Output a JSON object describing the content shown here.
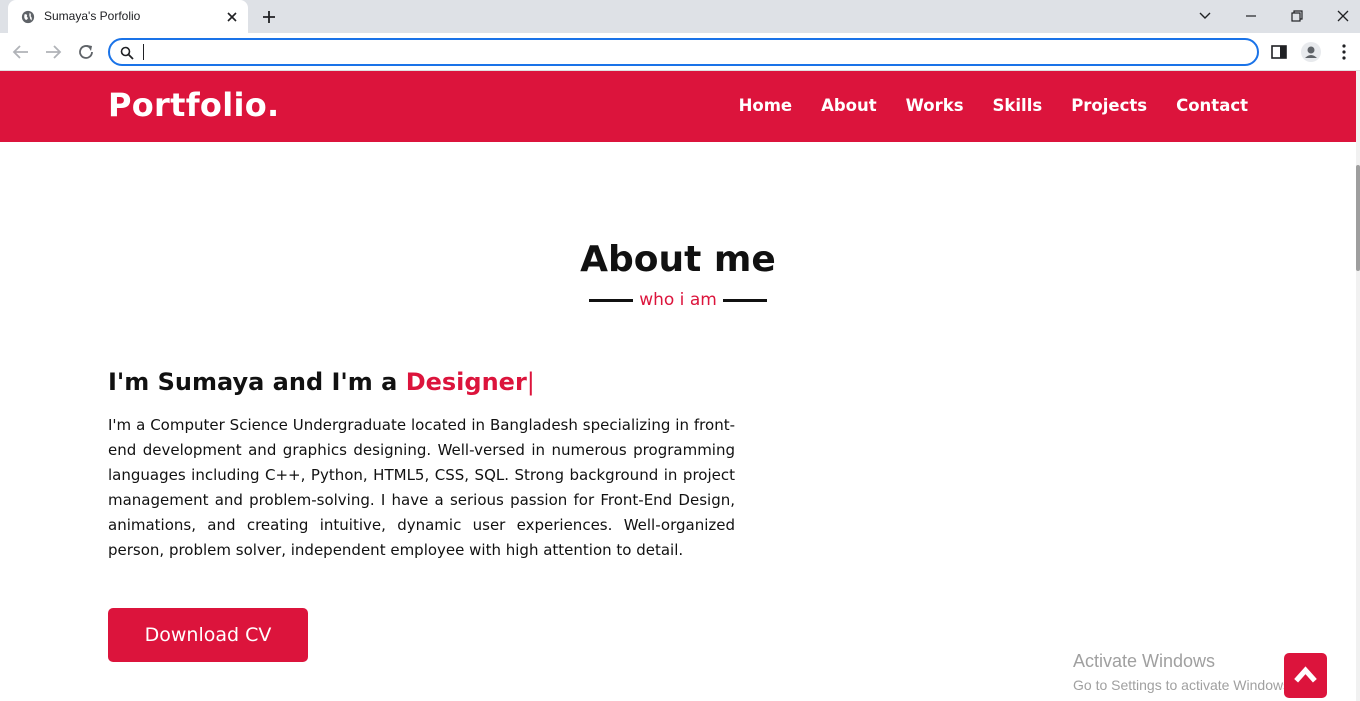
{
  "browser": {
    "tab_title": "Sumaya's Porfolio",
    "address_value": "",
    "address_placeholder": ""
  },
  "site": {
    "logo": "Portfolio.",
    "nav": [
      "Home",
      "About",
      "Works",
      "Skills",
      "Projects",
      "Contact"
    ]
  },
  "about": {
    "title": "About me",
    "subtitle": "who i am",
    "heading_prefix": "I'm Sumaya and I'm a ",
    "heading_highlight": "Designer",
    "heading_cursor": "|",
    "paragraph": "I'm a Computer Science Undergraduate located in Bangladesh specializing in front-end development and graphics designing. Well-versed in numerous programming languages including C++, Python, HTML5, CSS, SQL. Strong background in project management and problem-solving. I have a serious passion for Front-End Design, animations, and creating intuitive, dynamic user experiences. Well-organized person, problem solver, independent employee with high attention to detail.",
    "cv_button": "Download CV"
  },
  "os_watermark": {
    "title": "Activate Windows",
    "subtitle": "Go to Settings to activate Windows."
  },
  "colors": {
    "accent": "#dc143c",
    "text": "#111111",
    "chrome_bg": "#dee1e6",
    "focus": "#1a73e8"
  },
  "icons": {
    "tab_favicon": "globe-icon",
    "scroll_top": "chevron-up-icon"
  }
}
